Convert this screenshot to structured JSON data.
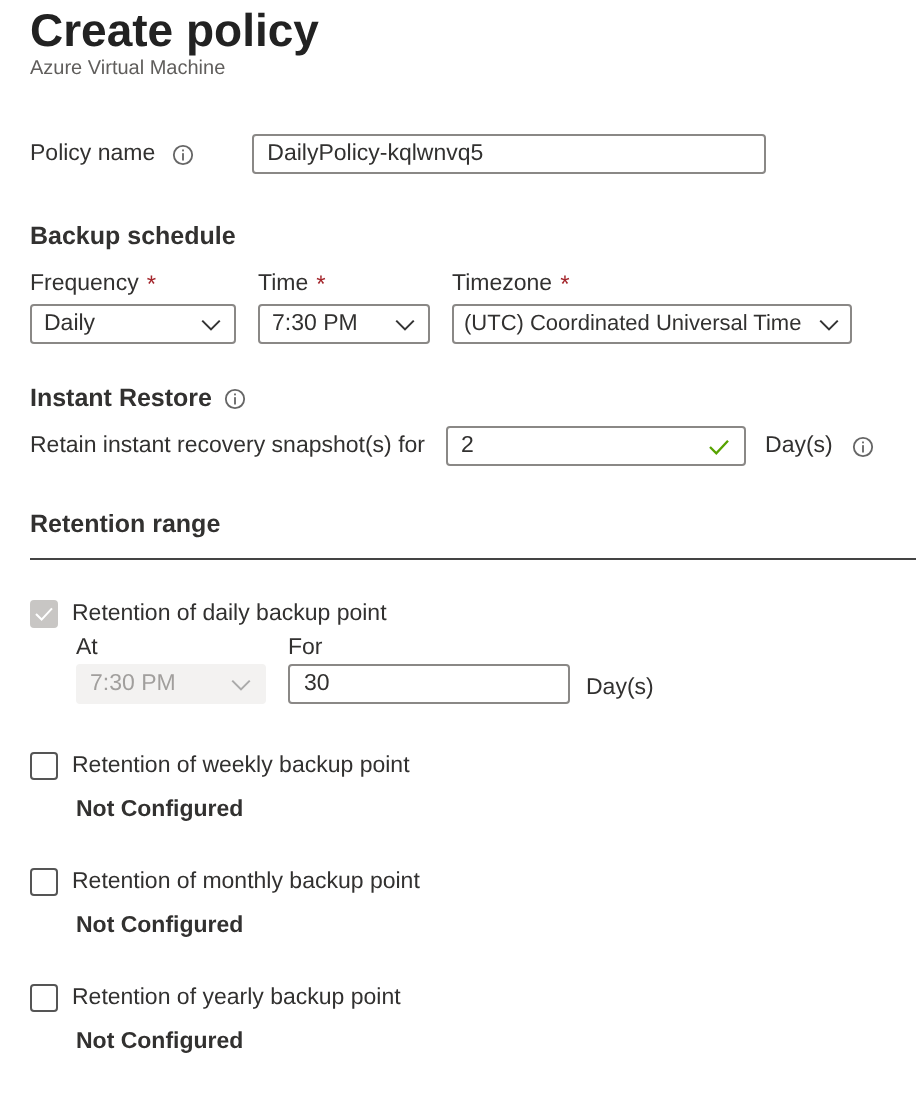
{
  "title": "Create policy",
  "subtitle": "Azure Virtual Machine",
  "policy_name": {
    "label": "Policy name",
    "value": "DailyPolicy-kqlwnvq5"
  },
  "backup_schedule": {
    "heading": "Backup schedule",
    "fields": [
      {
        "label": "Frequency",
        "required_mark": "*",
        "value": "Daily"
      },
      {
        "label": "Time",
        "required_mark": "*",
        "value": "7:30 PM"
      },
      {
        "label": "Timezone",
        "required_mark": "*",
        "value": "(UTC) Coordinated Universal Time"
      }
    ]
  },
  "instant_restore": {
    "heading": "Instant Restore",
    "label": "Retain instant recovery snapshot(s) for",
    "value": "2",
    "valid": true,
    "unit": "Day(s)"
  },
  "retention": {
    "heading": "Retention range",
    "items": [
      {
        "kind": "details",
        "label": "Retention of daily backup point",
        "checked": true,
        "disabled": true,
        "at_label": "At",
        "at_value": "7:30 PM",
        "at_disabled": true,
        "for_label": "For",
        "for_value": "30",
        "unit": "Day(s)"
      },
      {
        "kind": "status",
        "label": "Retention of weekly backup point",
        "checked": false,
        "disabled": false,
        "status": "Not Configured"
      },
      {
        "kind": "status",
        "label": "Retention of monthly backup point",
        "checked": false,
        "disabled": false,
        "status": "Not Configured"
      },
      {
        "kind": "status",
        "label": "Retention of yearly backup point",
        "checked": false,
        "disabled": false,
        "status": "Not Configured"
      }
    ]
  }
}
